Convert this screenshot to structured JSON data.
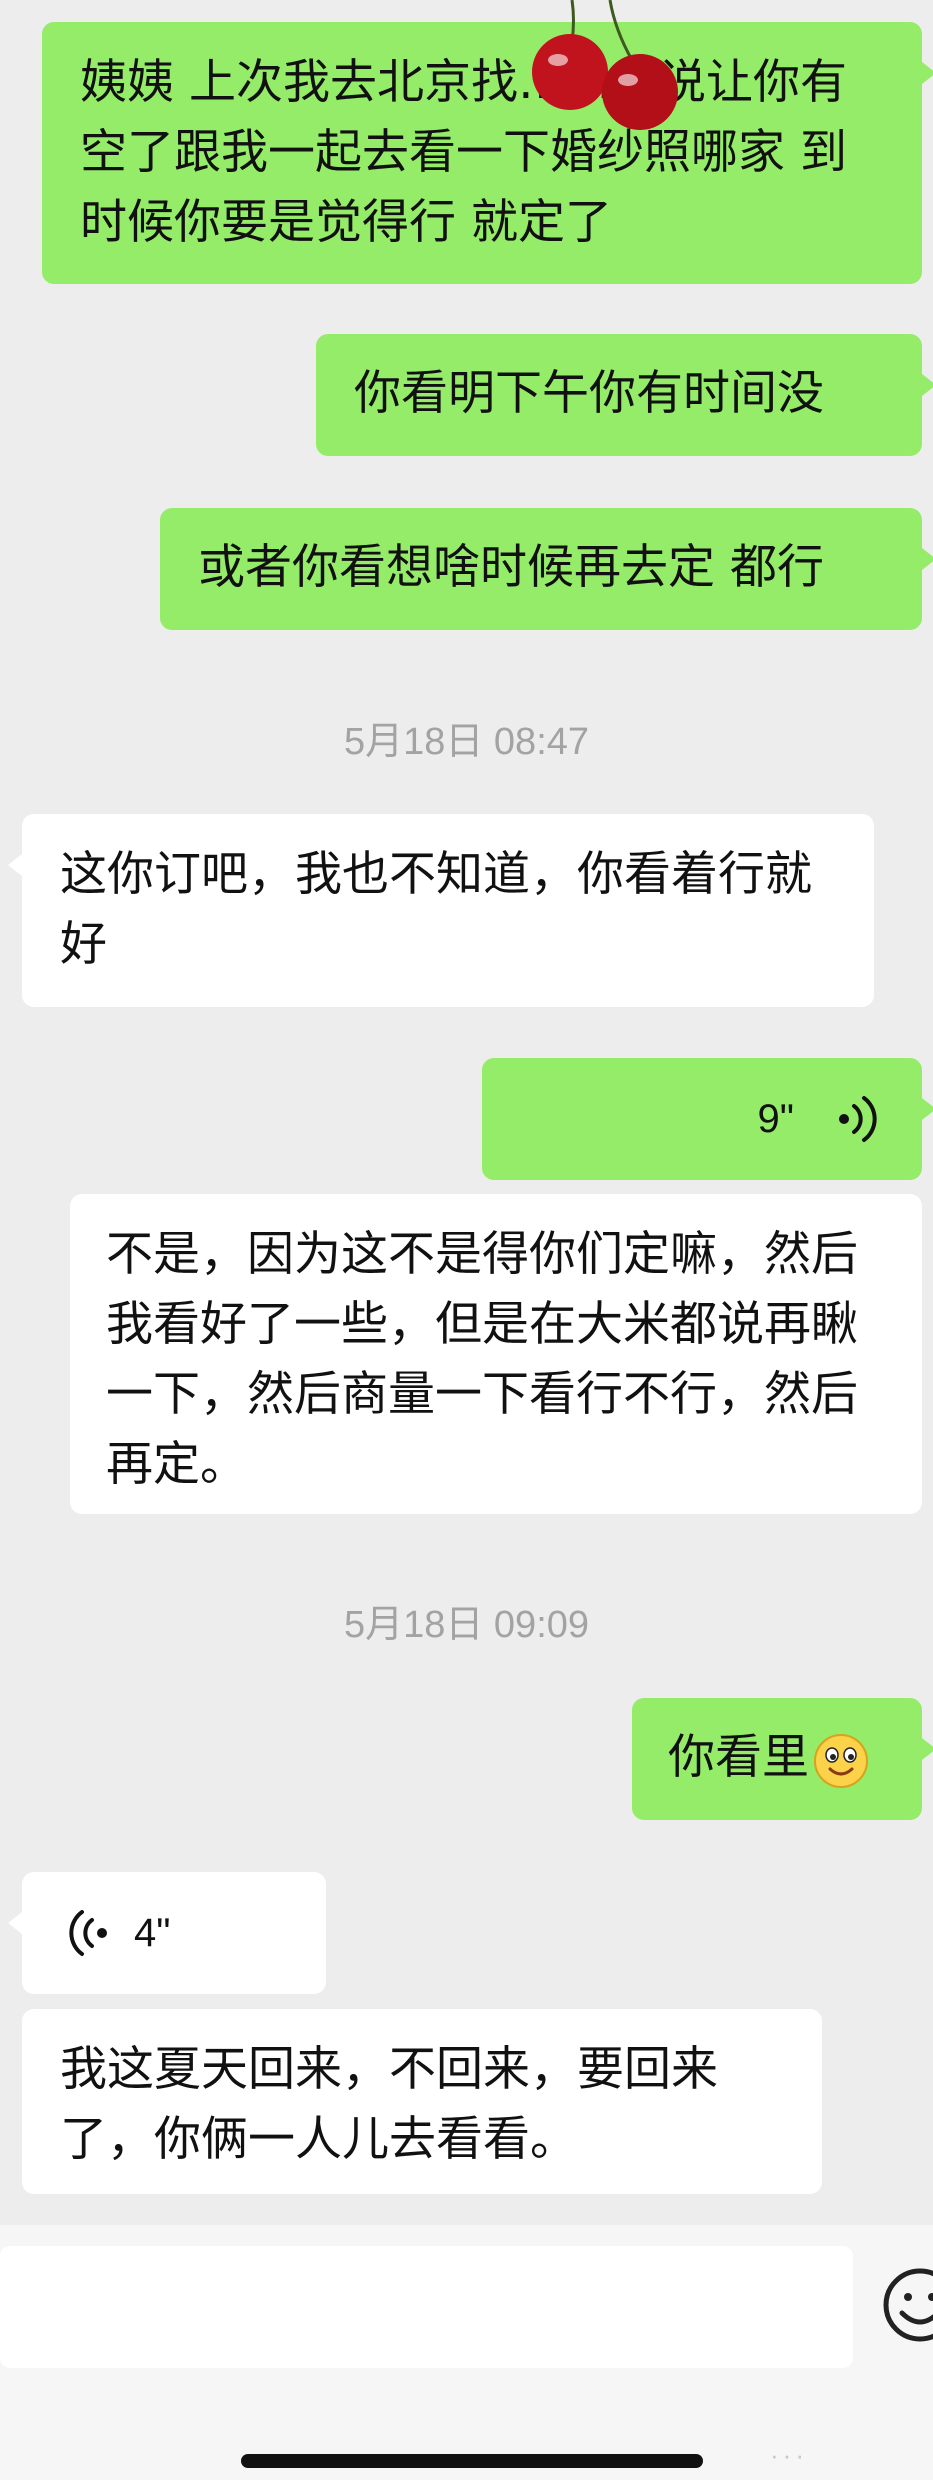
{
  "conversation": {
    "messages": [
      {
        "id": "m1",
        "sender": "me",
        "type": "text",
        "text": "姨姨 上次我去北京找……他说让你有空了跟我一起去看一下婚纱照哪家 到时候你要是觉得行 就定了"
      },
      {
        "id": "m2",
        "sender": "me",
        "type": "text",
        "text": "你看明下午你有时间没"
      },
      {
        "id": "m3",
        "sender": "me",
        "type": "text",
        "text": "或者你看想啥时候再去定 都行"
      },
      {
        "id": "t1",
        "type": "timestamp",
        "text": "5月18日 08:47"
      },
      {
        "id": "m4",
        "sender": "other",
        "type": "text",
        "text": "这你订吧，我也不知道，你看着行就好"
      },
      {
        "id": "m5",
        "sender": "me",
        "type": "voice",
        "duration": "9\""
      },
      {
        "id": "m5t",
        "sender": "me",
        "type": "transcript",
        "text": "不是，因为这不是得你们定嘛，然后我看好了一些，但是在大米都说再瞅一下，然后商量一下看行不行，然后再定。"
      },
      {
        "id": "t2",
        "type": "timestamp",
        "text": "5月18日 09:09"
      },
      {
        "id": "m6",
        "sender": "me",
        "type": "text",
        "text": "你看里",
        "emoji": "smiley-face"
      },
      {
        "id": "m7",
        "sender": "other",
        "type": "voice",
        "duration": "4\""
      },
      {
        "id": "m7t",
        "sender": "other",
        "type": "transcript",
        "text": "我这夏天回来，不回来，要回来了，你俩一人儿去看看。"
      }
    ]
  },
  "sticker": {
    "name": "cherries-sticker",
    "color": "#c0131d"
  },
  "input_bar": {
    "input_value": "",
    "emoji_icon": "emoji-face-icon"
  },
  "watermark": {
    "text": "··· "
  },
  "colors": {
    "my_bubble": "#95ec69",
    "other_bubble": "#ffffff",
    "background": "#ededed",
    "timestamp": "#a3a3a3"
  }
}
